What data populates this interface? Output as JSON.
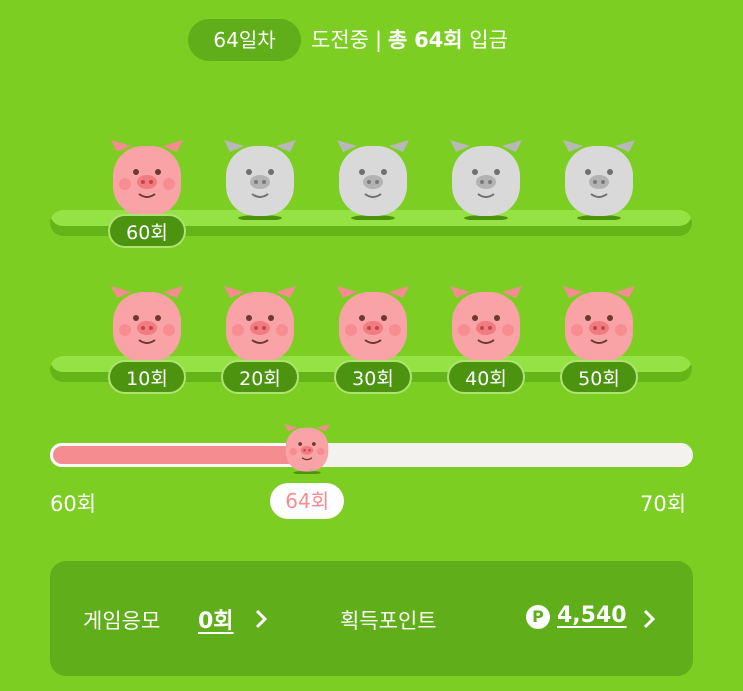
{
  "header": {
    "day_pill": "64일차",
    "status_prefix": "도전중",
    "separator": "|",
    "total_label": "총",
    "total_count": "64회",
    "deposit_label": "입금"
  },
  "row_top": {
    "pigs": [
      {
        "state": "filled",
        "icon": "pink-pig-icon"
      },
      {
        "state": "empty",
        "icon": "gray-pig-icon"
      },
      {
        "state": "empty",
        "icon": "gray-pig-icon"
      },
      {
        "state": "empty",
        "icon": "gray-pig-icon"
      },
      {
        "state": "empty",
        "icon": "gray-pig-icon"
      }
    ],
    "tags": [
      "60회"
    ]
  },
  "row_bottom": {
    "pigs": [
      {
        "state": "filled",
        "icon": "pink-pig-icon"
      },
      {
        "state": "filled",
        "icon": "pink-pig-icon"
      },
      {
        "state": "filled",
        "icon": "pink-pig-icon"
      },
      {
        "state": "filled",
        "icon": "pink-pig-icon"
      },
      {
        "state": "filled",
        "icon": "pink-pig-icon"
      }
    ],
    "tags": [
      "10회",
      "20회",
      "30회",
      "40회",
      "50회"
    ]
  },
  "progress": {
    "start_label": "60회",
    "end_label": "70회",
    "current_label": "64회",
    "fraction": 0.4
  },
  "panel": {
    "game_label": "게임응모",
    "game_value": "0회",
    "points_label": "획득포인트",
    "points_icon": "P",
    "points_value": "4,540"
  },
  "colors": {
    "background": "#7dce23",
    "pig_pink": "#f9a3a6",
    "pig_gray": "#d3d3d3",
    "progress_fill": "#f58c90"
  }
}
